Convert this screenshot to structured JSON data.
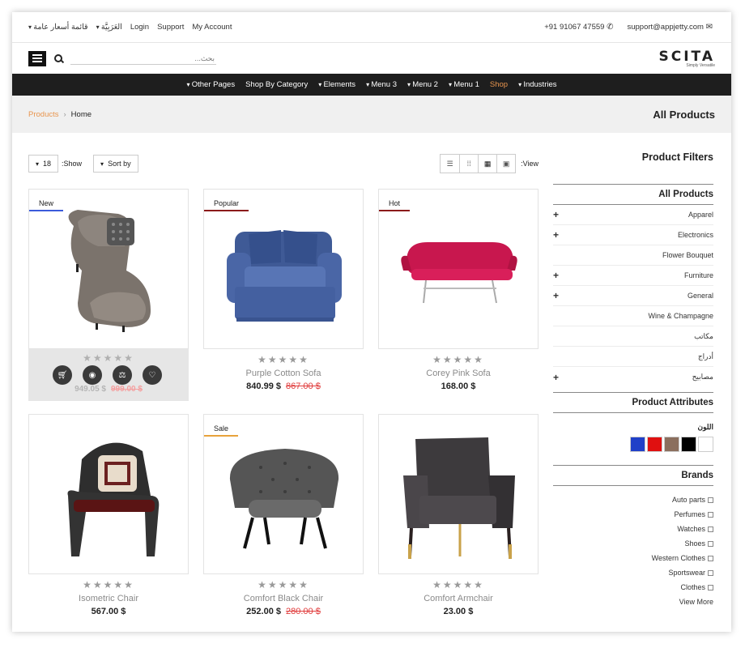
{
  "topbar": {
    "links": [
      {
        "label": "قائمة أسعار عامة",
        "dropdown": true
      },
      {
        "label": "العَرَبِيَّة",
        "dropdown": true
      },
      {
        "label": "Login",
        "dropdown": false
      },
      {
        "label": "Support",
        "dropdown": false
      },
      {
        "label": "My Account",
        "dropdown": false
      }
    ],
    "phone": "+91 91067 47559",
    "email": "support@appjetty.com"
  },
  "header": {
    "search_placeholder": "...بحث",
    "logo_main": "SCITA",
    "logo_sub": "Simply Versatile"
  },
  "nav": {
    "items": [
      {
        "label": "Other Pages",
        "dropdown": true,
        "active": false
      },
      {
        "label": "Shop By Category",
        "dropdown": false,
        "active": false
      },
      {
        "label": "Elements",
        "dropdown": true,
        "active": false
      },
      {
        "label": "Menu 3",
        "dropdown": true,
        "active": false
      },
      {
        "label": "Menu 2",
        "dropdown": true,
        "active": false
      },
      {
        "label": "Menu 1",
        "dropdown": true,
        "active": false
      },
      {
        "label": "Shop",
        "dropdown": false,
        "active": true
      },
      {
        "label": "Industries",
        "dropdown": true,
        "active": false
      }
    ],
    "active_color": "#e8954e"
  },
  "breadcrumb": {
    "first": "Products",
    "second": "Home",
    "separator": "›"
  },
  "page_title": "All Products",
  "toolbar": {
    "show_value": "18",
    "show_label": ":Show",
    "sort_label": "Sort by",
    "view_label": ":View"
  },
  "products": [
    {
      "tag": "New",
      "tag_color": "#3b5bdb",
      "name": "",
      "price": "949.05 $",
      "old_price": "999.00 $",
      "rating": "★★★★★",
      "hover": true
    },
    {
      "tag": "Popular",
      "tag_color": "#8b1a1a",
      "name": "Purple Cotton Sofa",
      "price": "840.99 $",
      "old_price": "867.00 $",
      "rating": "★★★★★",
      "hover": false
    },
    {
      "tag": "Hot",
      "tag_color": "#8b1a1a",
      "name": "Corey Pink Sofa",
      "price": "168.00 $",
      "old_price": "",
      "rating": "★★★★★",
      "hover": false
    },
    {
      "tag": "",
      "tag_color": "",
      "name": "Isometric Chair",
      "price": "567.00 $",
      "old_price": "",
      "rating": "★★★★★",
      "hover": false
    },
    {
      "tag": "Sale",
      "tag_color": "#e8a33b",
      "name": "Comfort Black Chair",
      "price": "252.00 $",
      "old_price": "280.00 $",
      "rating": "★★★★★",
      "hover": false
    },
    {
      "tag": "",
      "tag_color": "",
      "name": "Comfort Armchair",
      "price": "23.00 $",
      "old_price": "",
      "rating": "★★★★★",
      "hover": false
    }
  ],
  "sidebar": {
    "title": "Product Filters",
    "categories_title": "All Products",
    "categories": [
      {
        "label": "Apparel",
        "expandable": true
      },
      {
        "label": "Electronics",
        "expandable": true
      },
      {
        "label": "Flower Bouquet",
        "expandable": false
      },
      {
        "label": "Furniture",
        "expandable": true
      },
      {
        "label": "General",
        "expandable": true
      },
      {
        "label": "Wine & Champagne",
        "expandable": false
      },
      {
        "label": "مكاتب",
        "expandable": false
      },
      {
        "label": "أدراج",
        "expandable": false
      },
      {
        "label": "مصابيح",
        "expandable": true
      }
    ],
    "attributes_title": "Product Attributes",
    "color_label": "اللون",
    "colors": [
      "#2040c8",
      "#e01010",
      "#8b6f5e",
      "#000000",
      "#ffffff"
    ],
    "brands_title": "Brands",
    "brands": [
      "Auto parts",
      "Perfumes",
      "Watches",
      "Shoes",
      "Western Clothes",
      "Sportswear",
      "Clothes"
    ],
    "view_more": "View More"
  }
}
